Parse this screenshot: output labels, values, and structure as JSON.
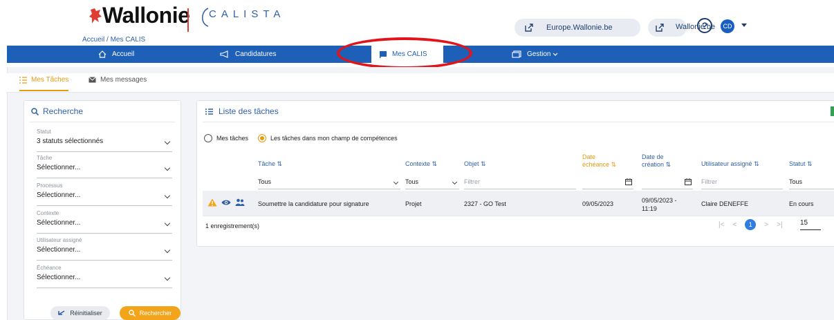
{
  "header": {
    "logo_text": "Wallonie",
    "app_name": "CALISTA",
    "breadcrumb": "Accueil / Mes CALIS",
    "links": [
      {
        "label": "Europe.Wallonie.be",
        "icon": "external-link-icon"
      },
      {
        "label": "Wallonie.be",
        "icon": "external-link-icon"
      }
    ],
    "help_icon": "?",
    "user_initials": "CD"
  },
  "nav": {
    "items": [
      {
        "label": "Accueil",
        "icon": "home-icon"
      },
      {
        "label": "Candidatures",
        "icon": "megaphone-icon"
      },
      {
        "label": "Mes CALIS",
        "icon": "flag-icon",
        "active": true
      },
      {
        "label": "Gestion",
        "icon": "windows-icon",
        "dropdown": true
      }
    ],
    "highlight_color": "#e2141b"
  },
  "tabs": [
    {
      "label": "Mes Tâches",
      "icon": "list-icon",
      "active": true
    },
    {
      "label": "Mes messages",
      "icon": "envelope-icon",
      "active": false
    }
  ],
  "search": {
    "title": "Recherche",
    "fields": [
      {
        "label": "Statut",
        "value": "3 statuts sélectionnés"
      },
      {
        "label": "Tâche",
        "value": "Sélectionner..."
      },
      {
        "label": "Processus",
        "value": "Sélectionner..."
      },
      {
        "label": "Contexte",
        "value": "Sélectionner..."
      },
      {
        "label": "Utilisateur assigné",
        "value": "Sélectionner..."
      },
      {
        "label": "Échéance",
        "value": "Sélectionner..."
      }
    ],
    "reset_label": "Réinitialiser",
    "search_label": "Rechercher"
  },
  "tasks": {
    "title": "Liste des tâches",
    "scope_options": [
      {
        "label": "Mes tâches",
        "checked": false
      },
      {
        "label": "Les tâches dans mon champ de compétences",
        "checked": true
      }
    ],
    "columns": [
      {
        "label": "Tâche",
        "sort": "⇅"
      },
      {
        "label": "Contexte",
        "sort": "⇅"
      },
      {
        "label": "Objet",
        "sort": "⇅"
      },
      {
        "label": "Date échéance",
        "sort": "⇅"
      },
      {
        "label": "Date de création",
        "sort": "⇅"
      },
      {
        "label": "Utilisateur assigné",
        "sort": "⇅"
      },
      {
        "label": "Statut",
        "sort": "⇅"
      }
    ],
    "filters": {
      "task": "Tous",
      "context": "Tous",
      "object": "Filtrer",
      "user": "Filtrer",
      "status": "Tous"
    },
    "rows": [
      {
        "task": "Soumettre la candidature pour signature",
        "context": "Projet",
        "object": "2327 - GO Test",
        "due_date": "09/05/2023",
        "created": "09/05/2023 - 11:19",
        "user": "Claire DENEFFE",
        "status": "En cours"
      }
    ],
    "count_label": "1 enregistrement(s)",
    "pager": {
      "first": "|<",
      "prev": "<",
      "current": "1",
      "next": ">",
      "last": ">|",
      "page_size": "15"
    }
  }
}
